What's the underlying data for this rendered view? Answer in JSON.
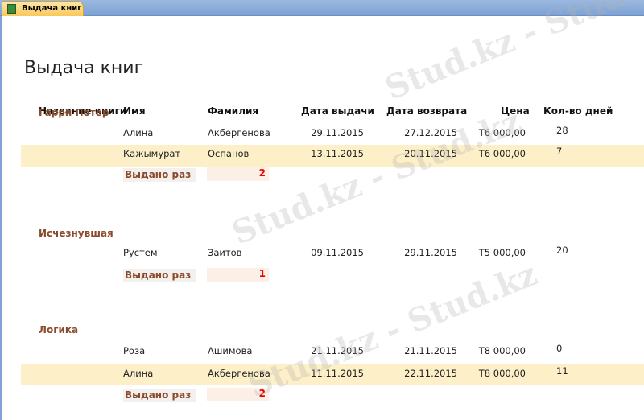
{
  "tab": {
    "label": "Выдача книг"
  },
  "report": {
    "title": "Выдача книг",
    "headers": [
      "Название книги",
      "Имя",
      "Фамилия",
      "Дата выдачи",
      "Дата возврата",
      "Цена",
      "Кол-во дней"
    ],
    "summary_label": "Выдано раз",
    "groups": [
      {
        "name": "Гарри Потер",
        "count": "2",
        "rows": [
          {
            "first": "Алина",
            "last": "Акбергенова",
            "issued": "29.11.2015",
            "returned": "27.12.2015",
            "price": "Т6 000,00",
            "days": "28"
          },
          {
            "first": "Кажымурат",
            "last": "Оспанов",
            "issued": "13.11.2015",
            "returned": "20.11.2015",
            "price": "Т6 000,00",
            "days": "7"
          }
        ]
      },
      {
        "name": "Исчезнувшая",
        "count": "1",
        "rows": [
          {
            "first": "Рустем",
            "last": "Заитов",
            "issued": "09.11.2015",
            "returned": "29.11.2015",
            "price": "Т5 000,00",
            "days": "20"
          }
        ]
      },
      {
        "name": "Логика",
        "count": "2",
        "rows": [
          {
            "first": "Роза",
            "last": "Ашимова",
            "issued": "21.11.2015",
            "returned": "21.11.2015",
            "price": "Т8 000,00",
            "days": "0"
          },
          {
            "first": "Алина",
            "last": "Акбергенова",
            "issued": "11.11.2015",
            "returned": "22.11.2015",
            "price": "Т8 000,00",
            "days": "11"
          }
        ]
      }
    ]
  },
  "watermark": "Stud.kz - Stud.kz"
}
